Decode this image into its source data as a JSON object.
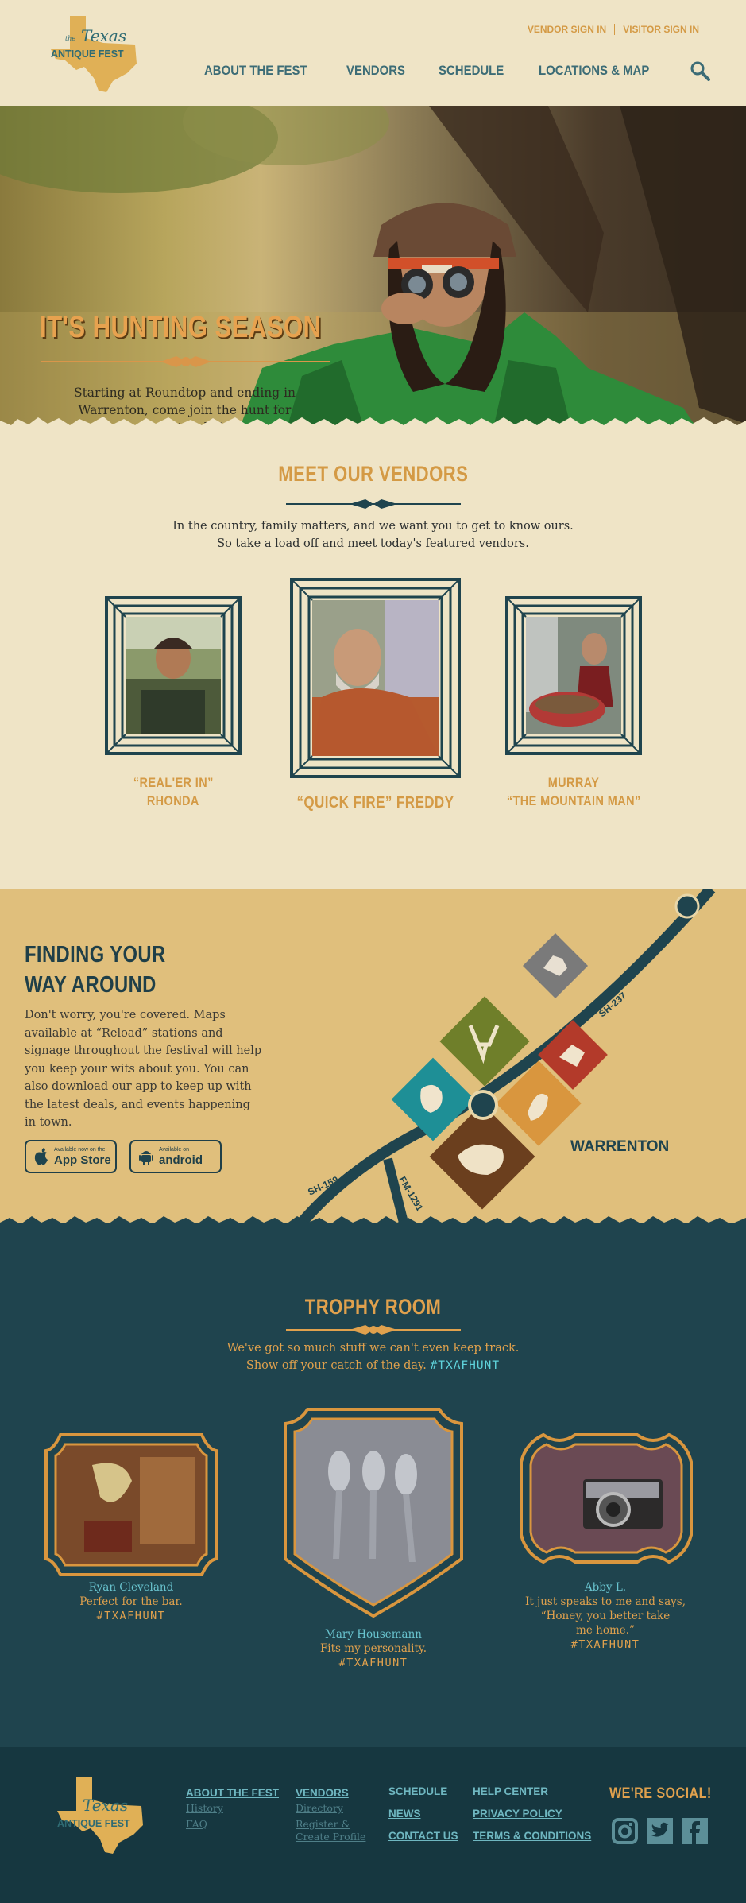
{
  "brand": {
    "logo_text_top": "Texas",
    "logo_text_bottom": "ANTIQUE FEST",
    "logo_prefix": "the"
  },
  "header": {
    "util_nav": [
      "VENDOR SIGN IN",
      "VISITOR SIGN IN"
    ],
    "main_nav": [
      "ABOUT THE FEST",
      "VENDORS",
      "SCHEDULE",
      "LOCATIONS & MAP"
    ],
    "search_icon": "magnifier-icon"
  },
  "hero": {
    "title": "IT'S HUNTING SEASON",
    "text": "Starting at Roundtop and ending in Warrenton, come join the hunt for your trophy!"
  },
  "vendors": {
    "title": "MEET OUR VENDORS",
    "intro_line1": "In the country, family matters, and we want you to get to know ours.",
    "intro_line2": "So take a load off and meet today's featured vendors.",
    "items": [
      {
        "name_line1": "“REAL'ER IN”",
        "name_line2": "RHONDA"
      },
      {
        "name_line1": "“QUICK FIRE” FREDDY",
        "name_line2": ""
      },
      {
        "name_line1": "MURRAY",
        "name_line2": "“THE MOUNTAIN MAN”"
      }
    ]
  },
  "map": {
    "title_line1": "FINDING YOUR",
    "title_line2": "WAY AROUND",
    "text": "Don't worry, you're covered. Maps available at “Reload” stations and signage throughout the festival will help you keep your wits about you. You can also download our app to keep up with the latest deals, and events happening in town.",
    "app_store_small": "Available now on the",
    "app_store_big": "App Store",
    "android_small": "Available on",
    "android_big": "android",
    "labels": {
      "town": "WARRENTON",
      "road_sh237": "SH-237",
      "road_sh159": "SH-159",
      "road_fm1291": "FM-1291"
    }
  },
  "trophy": {
    "title": "TROPHY ROOM",
    "intro_line1": "We've got so much stuff we can't even keep track.",
    "intro_line2": "Show off your catch of the day.",
    "hashtag": "#TXAFHUNT",
    "items": [
      {
        "name": "Ryan Cleveland",
        "quote": "Perfect for the bar.",
        "tag": "#TXAFHUNT"
      },
      {
        "name": "Mary Housemann",
        "quote": "Fits my personality.",
        "tag": "#TXAFHUNT"
      },
      {
        "name": "Abby L.",
        "quote_line1": "It just speaks to me and says,",
        "quote_line2": "“Honey, you better take",
        "quote_line3": "me home.”",
        "tag": "#TXAFHUNT"
      }
    ]
  },
  "footer": {
    "col1": {
      "head": "ABOUT THE FEST",
      "links": [
        "History",
        "FAQ"
      ]
    },
    "col2": {
      "head": "VENDORS",
      "links": [
        "Directory",
        "Register &",
        "Create Profile"
      ]
    },
    "col3": [
      "SCHEDULE",
      "NEWS",
      "CONTACT US"
    ],
    "col4": [
      "HELP CENTER",
      "PRIVACY POLICY",
      "TERMS & CONDITIONS"
    ],
    "social_title": "WE'RE SOCIAL!",
    "social_icons": [
      "instagram-icon",
      "twitter-icon",
      "facebook-icon"
    ]
  },
  "colors": {
    "accent_orange": "#d49a45",
    "teal_dark": "#1f444e",
    "teal_text": "#3c6c76",
    "cream": "#efe4c6",
    "sand": "#e0bf7c"
  }
}
